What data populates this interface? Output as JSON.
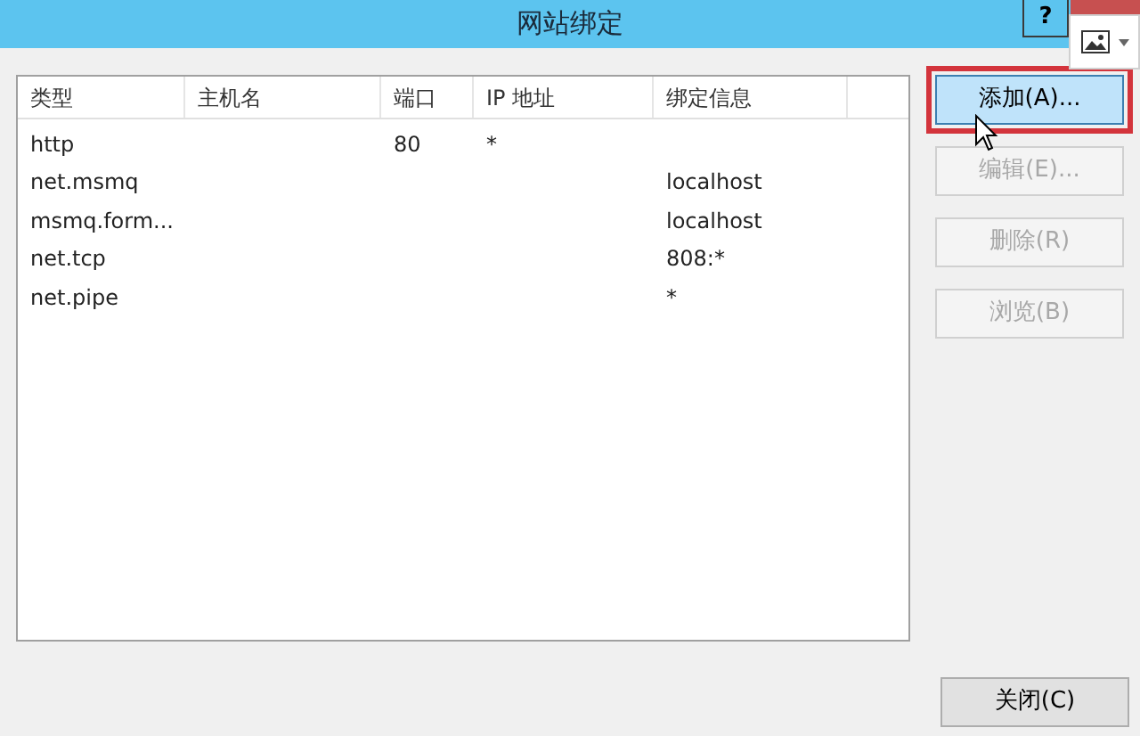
{
  "window": {
    "title": "网站绑定",
    "help_button": "?"
  },
  "table": {
    "columns": [
      "类型",
      "主机名",
      "端口",
      "IP 地址",
      "绑定信息"
    ],
    "rows": [
      [
        "http",
        "",
        "80",
        "*",
        ""
      ],
      [
        "net.msmq",
        "",
        "",
        "",
        "localhost"
      ],
      [
        "msmq.form...",
        "",
        "",
        "",
        "localhost"
      ],
      [
        "net.tcp",
        "",
        "",
        "",
        "808:*"
      ],
      [
        "net.pipe",
        "",
        "",
        "",
        "*"
      ]
    ]
  },
  "buttons": [
    {
      "label": "添加(A)...",
      "disabled": false,
      "highlighted": true
    },
    {
      "label": "编辑(E)...",
      "disabled": true,
      "highlighted": false
    },
    {
      "label": "删除(R)",
      "disabled": true,
      "highlighted": false
    },
    {
      "label": "浏览(B)",
      "disabled": true,
      "highlighted": false
    }
  ],
  "close_button": "关闭(C)"
}
